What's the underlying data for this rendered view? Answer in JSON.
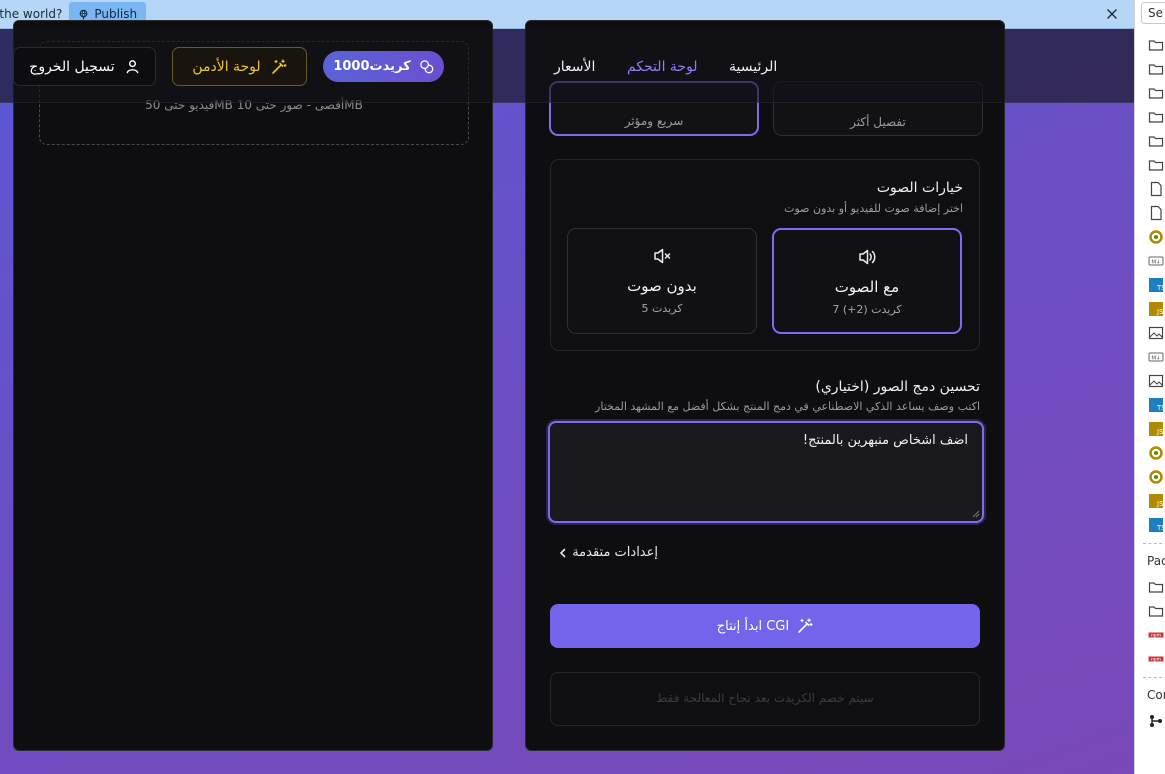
{
  "publish_bar": {
    "question": "n the world?",
    "publish_label": "Publish"
  },
  "header": {
    "logout_label": "تسجيل الخروج",
    "admin_label": "لوحة الأدمن",
    "credits_label": "1000كريدت",
    "nav": {
      "home": "الرئيسية",
      "dashboard": "لوحة التحكم",
      "pricing": "الأسعار"
    }
  },
  "left_panel": {
    "upload_hint": "فيديو حتى 50MB أقصى - صور حتى 10MB"
  },
  "style_cards": {
    "fast": {
      "subtitle": "سريع ومؤثر"
    },
    "detailed": {
      "subtitle": "تفصيل أكثر"
    }
  },
  "audio": {
    "title": "خيارات الصوت",
    "subtitle": "اختر إضافة صوت للفيديو أو بدون صوت",
    "options": [
      {
        "title": "مع الصوت",
        "cost": "كريدت (2+) 7",
        "selected": true,
        "icon": "speaker-on-icon"
      },
      {
        "title": "بدون صوت",
        "cost": "كريدت 5",
        "selected": false,
        "icon": "speaker-mute-icon"
      }
    ]
  },
  "enhance": {
    "title": "تحسين دمج الصور (اختياري)",
    "subtitle": "اكتب وصف يساعد الذكي الاصطناعي في دمج المنتج بشكل أفضل مع المشهد المختار",
    "value": "اضف اشخاص منبهرين بالمنتج!"
  },
  "advanced": {
    "label": "إعدادات متقدمة"
  },
  "generate": {
    "label": "ابدأ إنتاج CGI"
  },
  "notice": {
    "text": "سيتم خصم الكريدت بعد نجاح المعالجة فقط"
  },
  "explorer": {
    "search_text": "Se",
    "section_packages": "Pac",
    "section_console": "Con"
  },
  "colors": {
    "accent": "#7464ec",
    "admin_gold": "#f0c43a",
    "background": "#5b57d6"
  }
}
